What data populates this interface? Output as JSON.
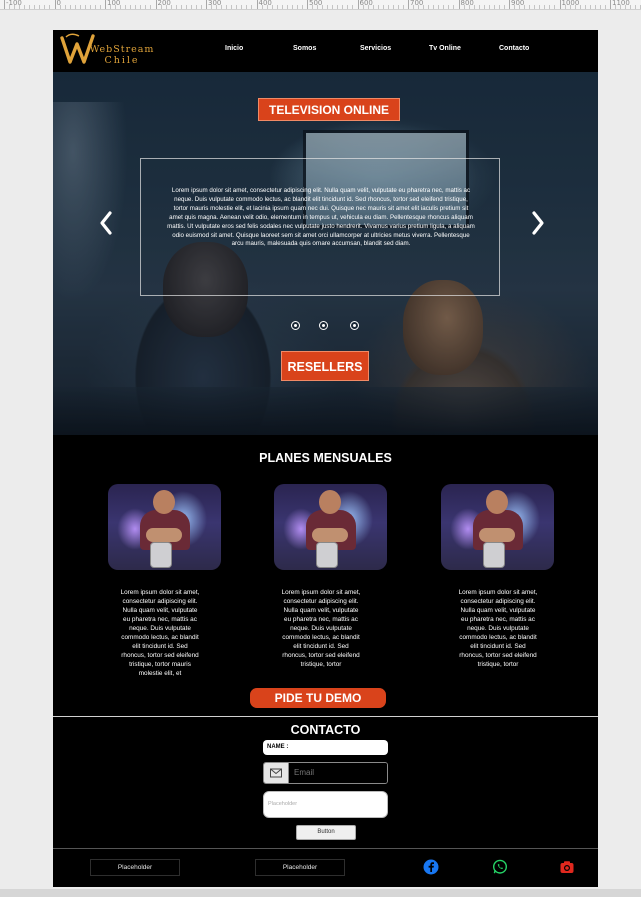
{
  "ruler": {
    "labels": [
      "-100",
      "0",
      "100",
      "200",
      "300",
      "400",
      "500",
      "600",
      "700",
      "800",
      "900",
      "1000",
      "1100"
    ]
  },
  "header": {
    "logo_lines": [
      "WebStream",
      "Chile"
    ],
    "nav": [
      "Inicio",
      "Somos",
      "Servicios",
      "Tv Online",
      "Contacto"
    ]
  },
  "hero": {
    "tv_button": "TELEVISION ONLINE",
    "body": "Lorem ipsum dolor sit amet, consectetur adipiscing elit. Nulla quam velit, vulputate eu pharetra nec, mattis ac neque. Duis vulputate commodo lectus, ac blandit elit tincidunt id. Sed rhoncus, tortor sed eleifend tristique, tortor mauris molestie elit, et lacinia ipsum quam nec dui. Quisque nec mauris sit amet elit iaculis pretium sit amet quis magna. Aenean velit odio, elementum in tempus ut, vehicula eu diam. Pellentesque rhoncus aliquam mattis. Ut vulputate eros sed felis sodales nec vulputate justo hendrerit. Vivamus varius pretium ligula, a aliquam odio euismod sit amet. Quisque laoreet sem sit amet orci ullamcorper at ultricies metus viverra. Pellentesque arcu mauris, malesuada quis ornare accumsan, blandit sed diam.",
    "slides": 3,
    "resellers_button": "RESELLERS"
  },
  "plans": {
    "title": "PLANES MENSUALES",
    "cards": [
      {
        "text": "Lorem ipsum dolor sit amet, consectetur adipiscing elit. Nulla quam velit, vulputate eu pharetra nec, mattis ac neque. Duis vulputate commodo lectus, ac blandit elit tincidunt id. Sed rhoncus, tortor sed eleifend tristique, tortor mauris molestie elit, et"
      },
      {
        "text": "Lorem ipsum dolor sit amet, consectetur adipiscing elit. Nulla quam velit, vulputate eu pharetra nec, mattis ac neque. Duis vulputate commodo lectus, ac blandit elit tincidunt id. Sed rhoncus, tortor sed eleifend tristique, tortor"
      },
      {
        "text": "Lorem ipsum dolor sit amet, consectetur adipiscing elit. Nulla quam velit, vulputate eu pharetra nec, mattis ac neque. Duis vulputate commodo lectus, ac blandit elit tincidunt id. Sed rhoncus, tortor sed eleifend tristique, tortor"
      }
    ],
    "demo_button": "PIDE TU DEMO"
  },
  "contact": {
    "title": "CONTACTO",
    "name_label": "NAME :",
    "email_placeholder": "Email",
    "textarea_placeholder": "Placeholder",
    "button_label": "Button"
  },
  "footer": {
    "buttons": [
      "Placeholder",
      "Placeholder"
    ],
    "social": [
      {
        "icon": "facebook-icon",
        "color": "#1877f2"
      },
      {
        "icon": "whatsapp-icon",
        "color": "#25d366"
      },
      {
        "icon": "instagram-icon",
        "color": "#e0281e"
      }
    ]
  },
  "colors": {
    "accent": "#d9431b",
    "logo_gold": "#e0a33a",
    "page_bg": "#000000"
  }
}
